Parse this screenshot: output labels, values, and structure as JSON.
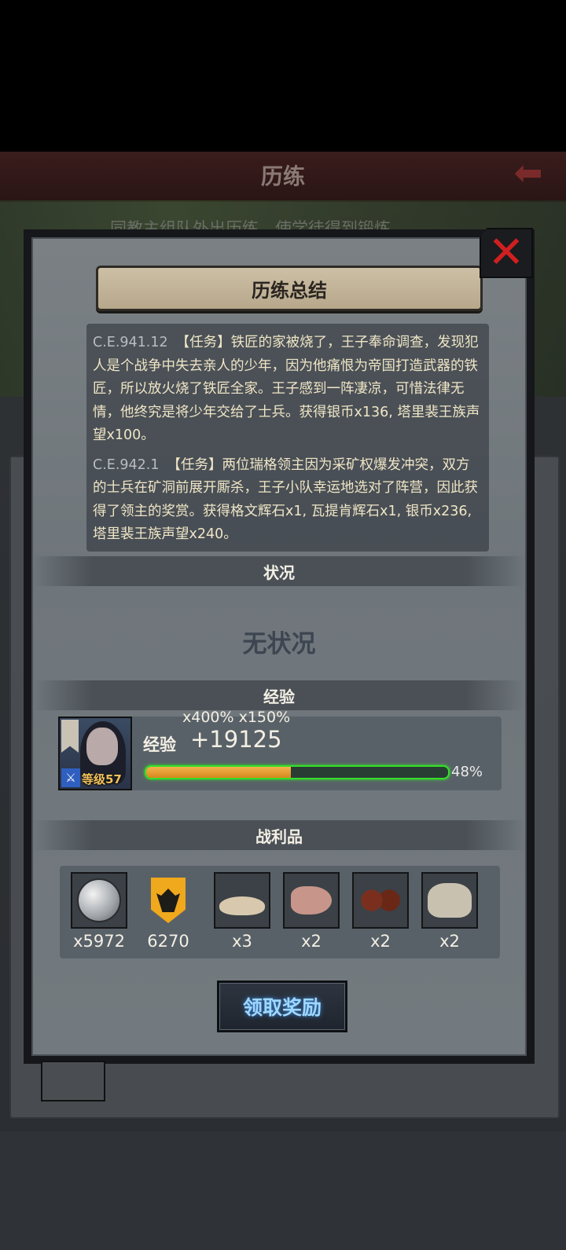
{
  "background": {
    "header_title": "历练",
    "subtitle": "同教主组队外出历练，使学徒得到锻炼"
  },
  "modal": {
    "title": "历练总结",
    "log": [
      {
        "date": "C.E.941.12",
        "text": "【任务】铁匠的家被烧了，王子奉命调查，发现犯人是个战争中失去亲人的少年，因为他痛恨为帝国打造武器的铁匠，所以放火烧了铁匠全家。王子感到一阵凄凉，可惜法律无情，他终究是将少年交给了士兵。获得银币x136, 塔里裴王族声望x100。"
      },
      {
        "date": "C.E.942.1",
        "text": "【任务】两位瑞格领主因为采矿权爆发冲突，双方的士兵在矿洞前展开厮杀，王子小队幸运地选对了阵营，因此获得了领主的奖赏。获得格文辉石x1, 瓦提肯辉石x1, 银币x236, 塔里裴王族声望x240。"
      }
    ],
    "status_header": "状况",
    "status_value": "无状况",
    "exp_header": "经验",
    "exp": {
      "multipliers": "x400%  x150%",
      "label": "经验",
      "value": "+19125",
      "level_label": "等级57",
      "progress_percent": 48,
      "progress_text": "48%"
    },
    "loot_header": "战利品",
    "loot": [
      {
        "icon": "silver-coin-icon",
        "count": "x5972"
      },
      {
        "icon": "royal-crest-icon",
        "count": "6270"
      },
      {
        "icon": "flour-icon",
        "count": "x3"
      },
      {
        "icon": "fish-icon",
        "count": "x2"
      },
      {
        "icon": "coffee-beans-icon",
        "count": "x2"
      },
      {
        "icon": "sugar-sack-icon",
        "count": "x2"
      }
    ],
    "claim_button": "领取奖励"
  }
}
